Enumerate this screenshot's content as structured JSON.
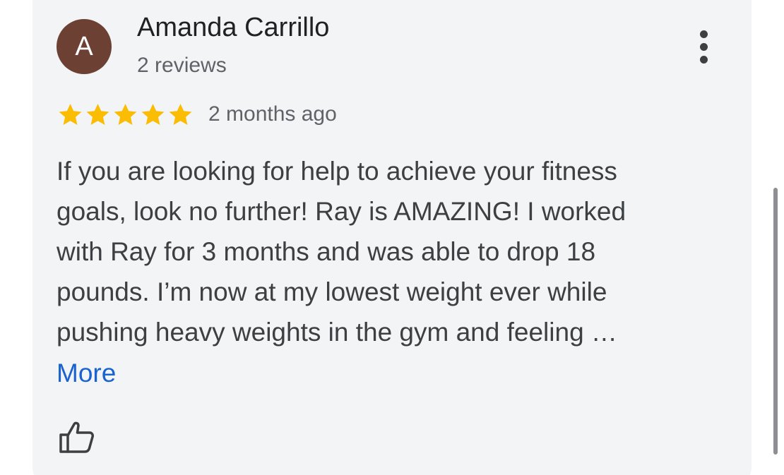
{
  "review": {
    "avatar_letter": "A",
    "avatar_color": "#6d4034",
    "reviewer_name": "Amanda Carrillo",
    "review_count": "2 reviews",
    "rating": 5,
    "rating_max": 5,
    "star_color": "#fbbc04",
    "date": "2 months ago",
    "text_lines": [
      "If you are looking for help to achieve your fitness",
      "goals, look no further! Ray is AMAZING! I worked",
      "with Ray for 3 months and was able to drop 18",
      "pounds. I’m now at my lowest weight ever while",
      "pushing heavy weights in the gym and feeling …"
    ],
    "more_label": "More",
    "more_color": "#1a62d0"
  },
  "icons": {
    "menu": "more-vert-icon",
    "like": "thumb-up-icon",
    "star": "star-icon"
  }
}
